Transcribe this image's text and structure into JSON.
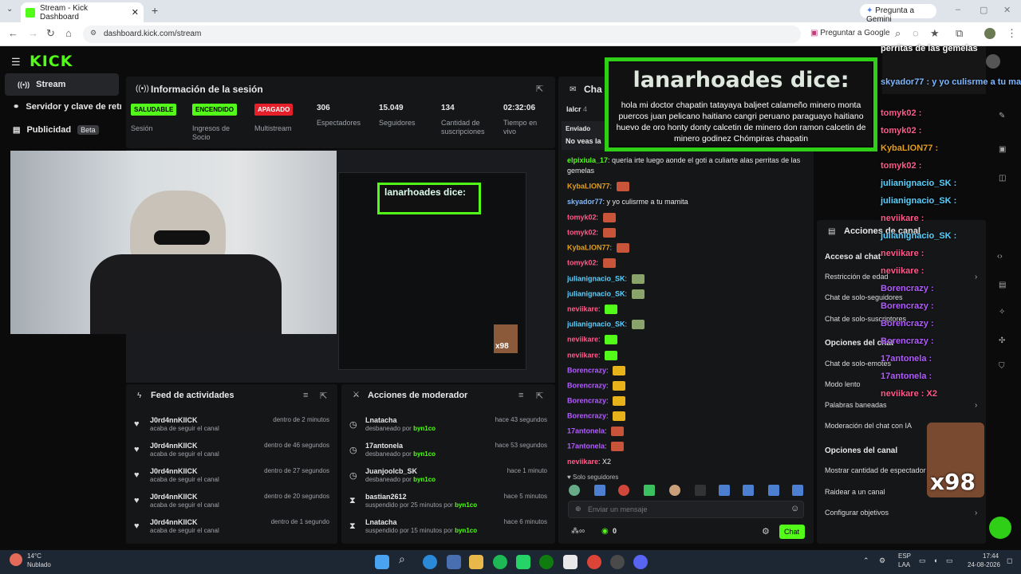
{
  "browser": {
    "tab_title": "Stream - Kick Dashboard",
    "url": "dashboard.kick.com/stream",
    "gemini": "Pregunta a Gemini",
    "google": "Preguntar a Google"
  },
  "sidebar": {
    "logo": "KICK",
    "items": [
      {
        "label": "Stream"
      },
      {
        "label": "Servidor y clave de retran"
      },
      {
        "label": "Publicidad",
        "badge": "Beta"
      }
    ]
  },
  "session": {
    "title": "Información de la sesión",
    "stats": [
      {
        "badge": "SALUDABLE",
        "label": "Sesión",
        "color": "#53fc18"
      },
      {
        "badge": "ENCENDIDO",
        "label": "Ingresos de Socio",
        "color": "#53fc18"
      },
      {
        "badge": "APAGADO",
        "label": "Multistream",
        "color": "#e5202b"
      },
      {
        "value": "306",
        "label": "Espectadores"
      },
      {
        "value": "15.049",
        "label": "Seguidores"
      },
      {
        "value": "134",
        "label": "Cantidad de suscripciones"
      },
      {
        "value": "02:32:06",
        "label": "Tiempo en vivo"
      }
    ]
  },
  "preview_overlay": {
    "title": "lanarhoades dice:",
    "badge": "x98"
  },
  "activity": {
    "title": "Feed de actividades",
    "rows": [
      {
        "name": "J0rd4nnKlICK",
        "time": "dentro de 2 minutos",
        "sub": "acaba de seguir el canal"
      },
      {
        "name": "J0rd4nnKlICK",
        "time": "dentro de 46 segundos",
        "sub": "acaba de seguir el canal"
      },
      {
        "name": "J0rd4nnKlICK",
        "time": "dentro de 27 segundos",
        "sub": "acaba de seguir el canal"
      },
      {
        "name": "J0rd4nnKlICK",
        "time": "dentro de 20 segundos",
        "sub": "acaba de seguir el canal"
      },
      {
        "name": "J0rd4nnKlICK",
        "time": "dentro de 1 segundo",
        "sub": "acaba de seguir el canal"
      }
    ]
  },
  "moderator": {
    "title": "Acciones de moderador",
    "rows": [
      {
        "name": "Lnatacha",
        "time": "hace 43 segundos",
        "action": "desbaneado por",
        "by": "byn1co"
      },
      {
        "name": "17antonela",
        "time": "hace 53 segundos",
        "action": "desbaneado por",
        "by": "byn1co"
      },
      {
        "name": "Juanjoolcb_SK",
        "time": "hace 1 minuto",
        "action": "desbaneado por",
        "by": "byn1co"
      },
      {
        "name": "bastian2612",
        "time": "hace 5 minutos",
        "action": "suspendido por 25 minutos por",
        "by": "byn1co"
      },
      {
        "name": "Lnatacha",
        "time": "hace 6 minutos",
        "action": "suspendido por 15 minutos por",
        "by": "byn1co"
      }
    ]
  },
  "chat": {
    "title": "Cha",
    "top_user": "lalcr",
    "top_count": "4",
    "sent": "Enviado",
    "no_ves": "No veas la",
    "messages": [
      {
        "user": "elpixiula_17",
        "text": "quería irte luego aonde el goti a culiarte alas perritas de las",
        "color": "#53fc18"
      },
      {
        "user": "",
        "text": "gemelas",
        "color": "#ddd"
      },
      {
        "user": "KybaLION77",
        "text": "",
        "color": "#e59f1a",
        "emote": "#c8543a"
      },
      {
        "user": "skyador77",
        "text": "y yo culisrme a tu mamita",
        "color": "#7fb7ff"
      },
      {
        "user": "tomyk02",
        "text": "",
        "color": "#ff5a8a",
        "emote": "#c8543a"
      },
      {
        "user": "tomyk02",
        "text": "",
        "color": "#ff5a8a",
        "emote": "#c8543a"
      },
      {
        "user": "KybaLION77",
        "text": "",
        "color": "#e59f1a",
        "emote": "#c8543a"
      },
      {
        "user": "tomyk02",
        "text": "",
        "color": "#ff5a8a",
        "emote": "#c8543a"
      },
      {
        "user": "julianignacio_SK",
        "text": "",
        "color": "#5ad1ff",
        "emote": "#8aa36a"
      },
      {
        "user": "julianignacio_SK",
        "text": "",
        "color": "#5ad1ff",
        "emote": "#8aa36a"
      },
      {
        "user": "neviikare",
        "text": "",
        "color": "#ff5a8a",
        "emote": "#53fc18"
      },
      {
        "user": "julianignacio_SK",
        "text": "",
        "color": "#5ad1ff",
        "emote": "#8aa36a"
      },
      {
        "user": "neviikare",
        "text": "",
        "color": "#ff5a8a",
        "emote": "#53fc18"
      },
      {
        "user": "neviikare",
        "text": "",
        "color": "#ff5a8a",
        "emote": "#53fc18"
      },
      {
        "user": "Borencrazy",
        "text": "",
        "color": "#b25cff",
        "emote": "#e8b21a"
      },
      {
        "user": "Borencrazy",
        "text": "",
        "color": "#b25cff",
        "emote": "#e8b21a"
      },
      {
        "user": "Borencrazy",
        "text": "",
        "color": "#b25cff",
        "emote": "#e8b21a"
      },
      {
        "user": "Borencrazy",
        "text": "",
        "color": "#b25cff",
        "emote": "#e8b21a"
      },
      {
        "user": "17antonela",
        "text": "",
        "color": "#b25cff",
        "emote": "#c8543a"
      },
      {
        "user": "17antonela",
        "text": "",
        "color": "#b25cff",
        "emote": "#c8543a"
      },
      {
        "user": "neviikare",
        "text": "X2",
        "color": "#ff5a8a"
      }
    ],
    "mode": "Solo seguidores",
    "input_placeholder": "Enviar un mensaje",
    "send": "Chat",
    "count": "0"
  },
  "channel_actions": {
    "title": "Acciones de canal",
    "sec_access": "Acceso al chat",
    "rows_access": [
      {
        "label": "Restricción de edad"
      },
      {
        "label": "Chat de solo-seguidores"
      },
      {
        "label": "Chat de solo-suscriptores"
      }
    ],
    "sec_chat": "Opciones del chat",
    "rows_chat": [
      {
        "label": "Chat de solo-emotes"
      },
      {
        "label": "Modo lento"
      },
      {
        "label": "Palabras baneadas"
      },
      {
        "label": "Moderación del chat con IA"
      }
    ],
    "sec_channel": "Opciones del canal",
    "rows_channel": [
      {
        "label": "Mostrar cantidad de espectador"
      },
      {
        "label": "Raidear a un canal"
      },
      {
        "label": "Configurar objetivos"
      }
    ]
  },
  "overlay": {
    "title": "lanarhoades dice:",
    "message": "hola mi doctor chapatin tatayaya baljeet calameño minero monta puercos juan pelicano haitiano cangri peruano paraguayo haitiano huevo de oro honty donty calcetin de minero don ramon calcetin de minero godinez Chómpiras chapatin",
    "badge": "x98",
    "chat_lines": [
      {
        "user": "perritas de las gemelas",
        "color": "#ffffff"
      },
      {
        "user": "skyador77 : y yo culisrme a tu mamita",
        "color": "#7fb7ff"
      },
      {
        "user": "tomyk02 :",
        "color": "#ff5a8a"
      },
      {
        "user": "tomyk02 :",
        "color": "#ff5a8a"
      },
      {
        "user": "KybaLION77 :",
        "color": "#e59f1a"
      },
      {
        "user": "tomyk02 :",
        "color": "#ff5a8a"
      },
      {
        "user": "julianignacio_SK :",
        "color": "#5ad1ff"
      },
      {
        "user": "julianignacio_SK :",
        "color": "#5ad1ff"
      },
      {
        "user": "neviikare :",
        "color": "#ff5a8a"
      },
      {
        "user": "julianignacio_SK :",
        "color": "#5ad1ff"
      },
      {
        "user": "neviikare :",
        "color": "#ff5a8a"
      },
      {
        "user": "neviikare :",
        "color": "#ff5a8a"
      },
      {
        "user": "Borencrazy :",
        "color": "#b25cff"
      },
      {
        "user": "Borencrazy :",
        "color": "#b25cff"
      },
      {
        "user": "Borencrazy :",
        "color": "#b25cff"
      },
      {
        "user": "Borencrazy :",
        "color": "#b25cff"
      },
      {
        "user": "17antonela :",
        "color": "#b25cff"
      },
      {
        "user": "17antonela :",
        "color": "#b25cff"
      },
      {
        "user": "neviikare : X2",
        "color": "#ff5a8a"
      }
    ]
  },
  "taskbar": {
    "weather_temp": "14°C",
    "weather_desc": "Nublado",
    "lang1": "ESP",
    "lang2": "LAA",
    "time": "17:44",
    "date": "24-08-2026"
  }
}
